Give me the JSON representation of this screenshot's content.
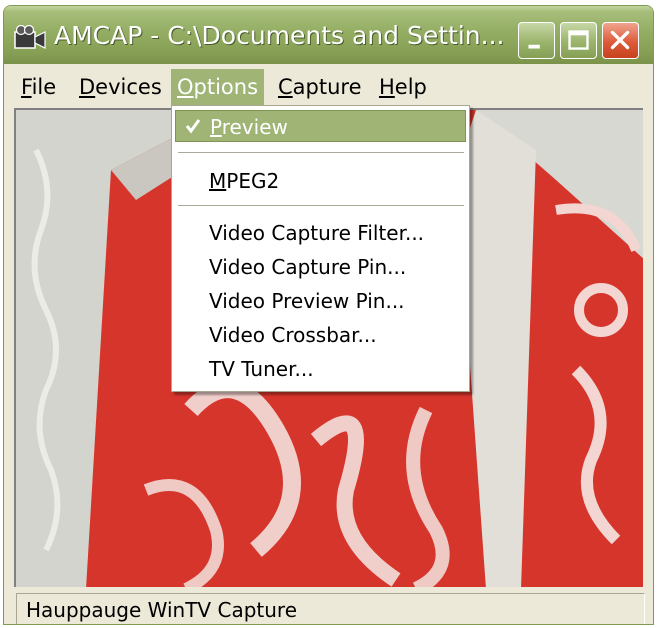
{
  "window": {
    "title": "AMCAP - C:\\Documents and Settin...",
    "icon": "camera-icon",
    "buttons": {
      "minimize": "minimize-icon",
      "maximize": "maximize-icon",
      "close": "close-icon"
    }
  },
  "menubar": {
    "items": [
      {
        "label": "File",
        "accelerator": "F",
        "rest": "ile"
      },
      {
        "label": "Devices",
        "accelerator": "D",
        "rest": "evices"
      },
      {
        "label": "Options",
        "accelerator": "O",
        "rest": "ptions",
        "active": true
      },
      {
        "label": "Capture",
        "accelerator": "C",
        "rest": "apture"
      },
      {
        "label": "Help",
        "accelerator": "H",
        "rest": "elp"
      }
    ]
  },
  "options_menu": {
    "preview": {
      "label": "Preview",
      "accelerator": "P",
      "rest": "review",
      "checked": true
    },
    "mpeg2": {
      "label": "MPEG2",
      "accelerator": "M",
      "rest": "PEG2"
    },
    "items": [
      "Video Capture Filter...",
      "Video Capture Pin...",
      "Video Preview Pin...",
      "Video Crossbar...",
      "TV Tuner..."
    ]
  },
  "statusbar": {
    "text": "Hauppauge WinTV Capture"
  },
  "colors": {
    "titlebar": "#93ad63",
    "menu_highlight": "#9fb475",
    "close_button": "#dc5a3a",
    "window_face": "#ece9d8"
  }
}
